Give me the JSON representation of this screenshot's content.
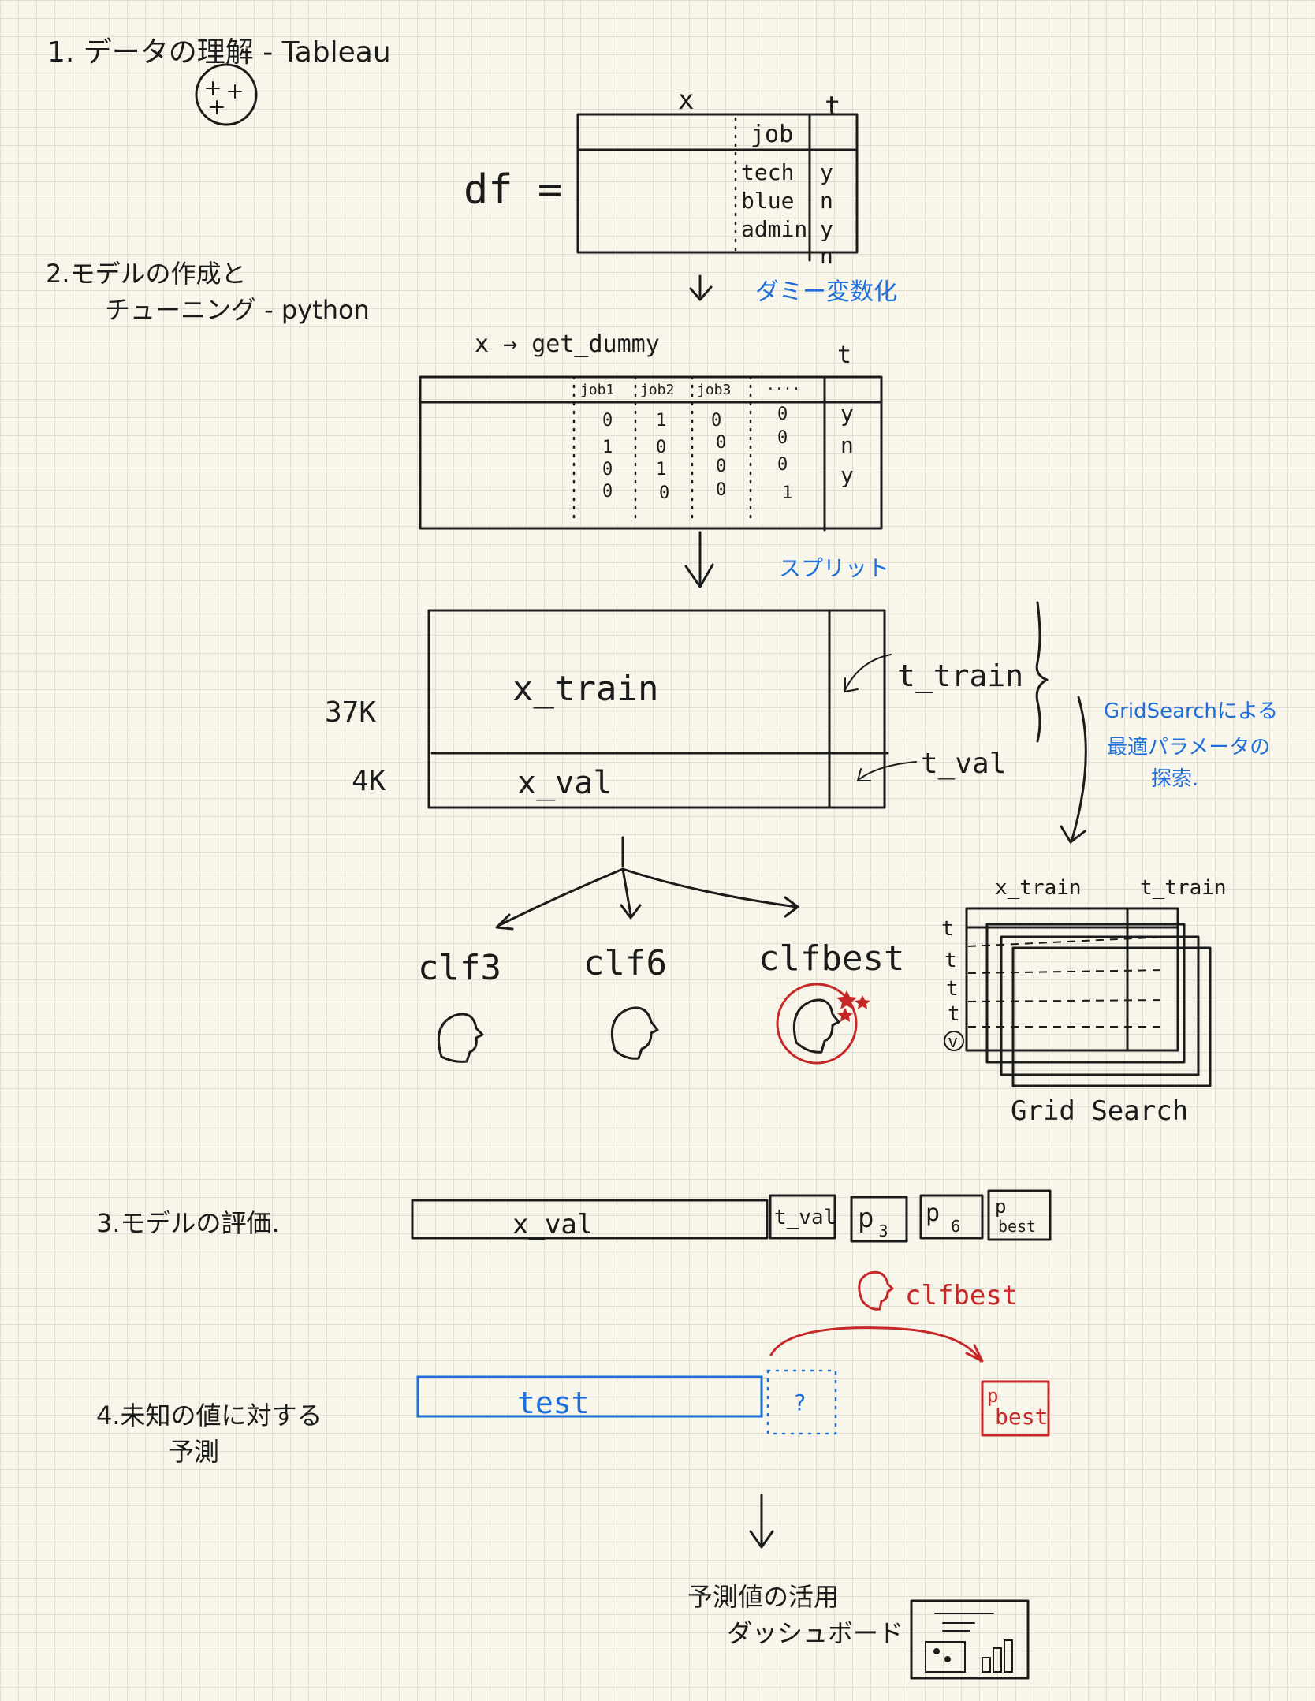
{
  "colors": {
    "ink": "#1b1b1b",
    "blue": "#1e6fd9",
    "red": "#c62828",
    "paper": "#f8f5ea",
    "grid": "#e2ddd0"
  },
  "steps": {
    "step1": "1. データの理解 - Tableau",
    "step2_line1": "2.モデルの作成と",
    "step2_line2": "チューニング - python",
    "step3": "3.モデルの評価.",
    "step4_line1": "4.未知の値に対する",
    "step4_line2": "予測"
  },
  "df_table": {
    "df_label": "df =",
    "x_label": "x",
    "t_label": "t",
    "column_header": "job",
    "job_values": [
      "tech",
      "blue",
      "admin"
    ],
    "t_values": [
      "y",
      "n",
      "y",
      "n"
    ]
  },
  "annotations": {
    "dummy": "ダミー変数化",
    "split": "スプリット",
    "grid_search_line1": "GridSearchによる",
    "grid_search_line2": "最適パラメータの",
    "grid_search_line3": "探索."
  },
  "dummy_table": {
    "x_label": "x → get_dummy",
    "t_label": "t",
    "headers": [
      "job1",
      "job2",
      "job3",
      "...."
    ],
    "rows": [
      [
        "0",
        "1",
        "0",
        "0",
        "y"
      ],
      [
        "1",
        "0",
        "0",
        "0",
        "n"
      ],
      [
        "0",
        "1",
        "0",
        "0",
        "y"
      ],
      [
        "0",
        "0",
        "0",
        "1",
        ""
      ]
    ]
  },
  "split": {
    "train_size": "37K",
    "val_size": "4K",
    "x_train": "x_train",
    "x_val": "x_val",
    "t_train": "t_train",
    "t_val": "t_val"
  },
  "models": [
    "clf3",
    "clf6",
    "clfbest"
  ],
  "grid_search": {
    "x_header": "x_train",
    "t_header": "t_train",
    "row_marks": [
      "t",
      "t",
      "t",
      "t",
      "v"
    ],
    "label": "Grid Search"
  },
  "evaluation": {
    "x_val": "x_val",
    "t_val": "t_val",
    "p3": {
      "base": "p",
      "sub": "3"
    },
    "p6": {
      "base": "p",
      "sub": "6"
    },
    "pbest": {
      "base": "p",
      "sub": "best"
    }
  },
  "prediction": {
    "test": "test",
    "unknown": "?",
    "model": "clfbest",
    "pbest": {
      "base": "p",
      "sub": "best"
    }
  },
  "usage": {
    "line1": "予測値の活用",
    "line2": "ダッシュボード"
  }
}
